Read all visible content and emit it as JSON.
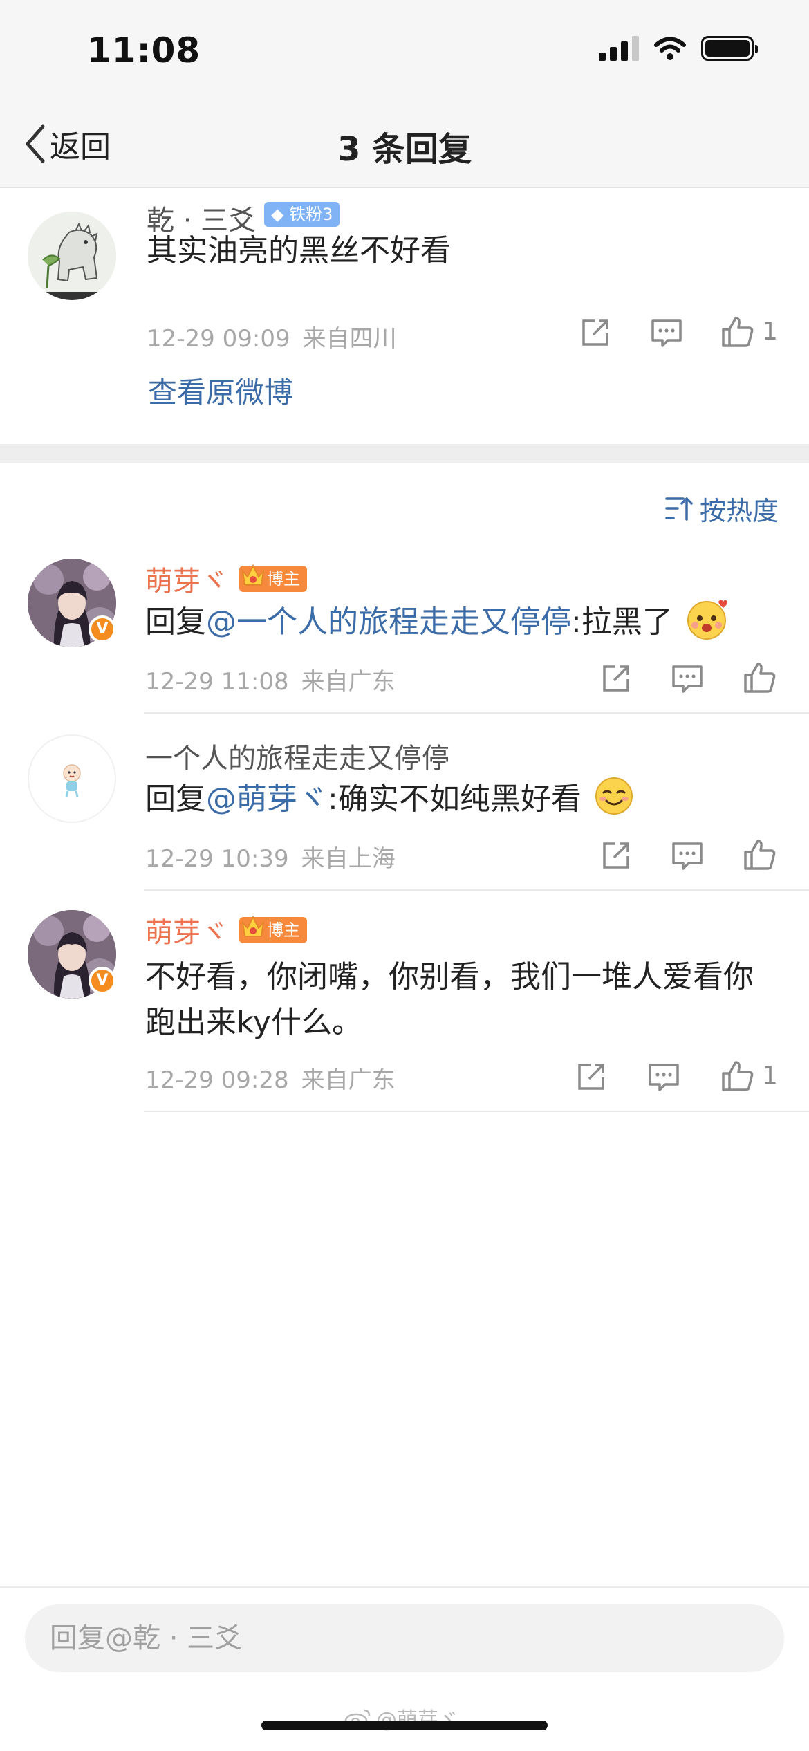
{
  "status_bar": {
    "time": "11:08",
    "battery_level": 1.0,
    "signal_bars": 4
  },
  "nav": {
    "back_label": "返回",
    "title": "3 条回复"
  },
  "post": {
    "username": "乾 · 三爻",
    "fan_badge": "铁粉3",
    "text": "其实油亮的黑丝不好看",
    "time": "12-29 09:09",
    "location": "来自四川",
    "like_count": "1",
    "view_original_label": "查看原微博"
  },
  "sort": {
    "label": "按热度"
  },
  "replies": [
    {
      "username": "萌芽ヾ",
      "badge": "博主",
      "reply_prefix": "回复",
      "mention": "@一个人的旅程走走又停停",
      "text": ":拉黑了",
      "emoji": "cute-surprised-face",
      "time": "12-29 11:08",
      "location": "来自广东",
      "like_count": ""
    },
    {
      "username": "一个人的旅程走走又停停",
      "reply_prefix": "回复",
      "mention": "@萌芽ヾ",
      "text": ":确实不如纯黑好看",
      "emoji": "smirk-face",
      "time": "12-29 10:39",
      "location": "来自上海",
      "like_count": ""
    },
    {
      "username": "萌芽ヾ",
      "badge": "博主",
      "text_line1": "不好看，你闭嘴，你别看，我们一堆人爱看你",
      "text_line2": "跑出来ky什么。",
      "time": "12-29 09:28",
      "location": "来自广东",
      "like_count": "1"
    }
  ],
  "reply_bar": {
    "placeholder": "回复@乾 · 三爻",
    "watermark": "@萌芽ヾ"
  },
  "colors": {
    "link": "#3c6ca8",
    "username_highlight": "#eb7350",
    "meta": "#a8a8a8",
    "blogger_badge": "#f6893c",
    "fan_badge": "#7fb3f5"
  }
}
